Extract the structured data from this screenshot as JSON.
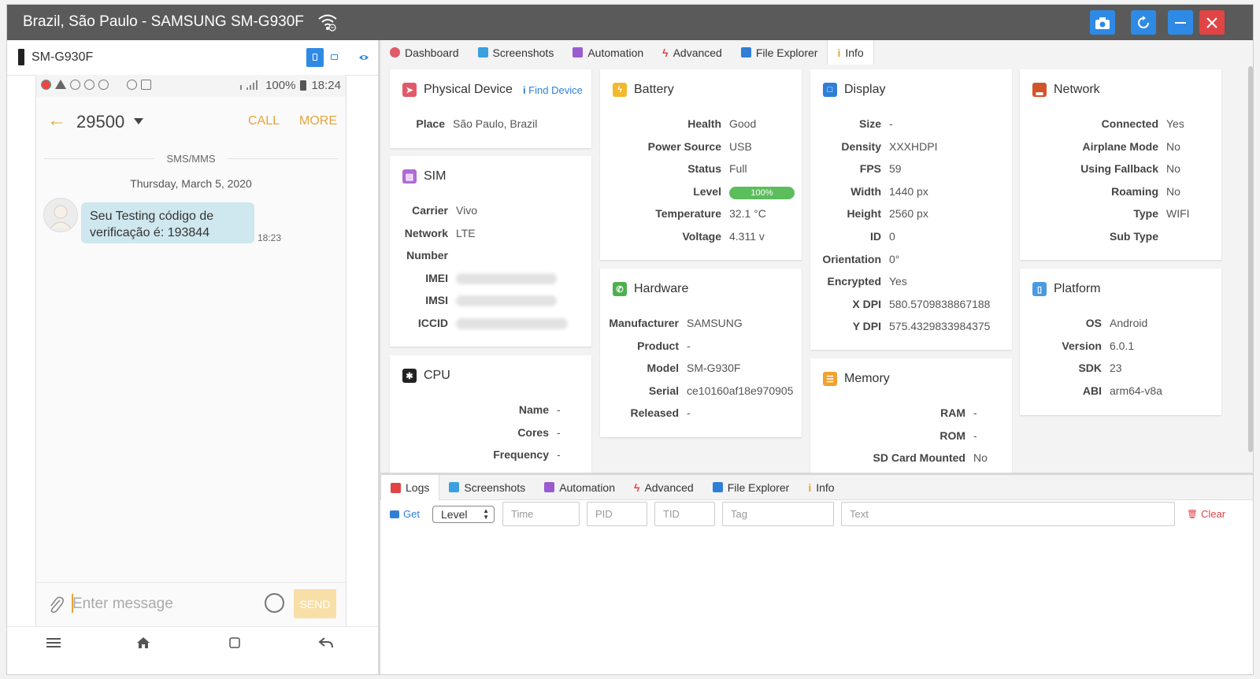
{
  "window": {
    "title": "Brazil, São Paulo - SAMSUNG SM-G930F"
  },
  "device": {
    "name": "SM-G930F"
  },
  "phone": {
    "status": {
      "battery": "100%",
      "time": "18:24"
    },
    "conversation": {
      "number": "29500",
      "call": "CALL",
      "more": "MORE"
    },
    "sms_label": "SMS/MMS",
    "date": "Thursday, March 5, 2020",
    "message": {
      "text": "Seu Testing código de verificação é: 193844",
      "time": "18:23"
    },
    "composer": {
      "placeholder": "Enter message",
      "send": "SEND"
    }
  },
  "tabs": [
    "Dashboard",
    "Screenshots",
    "Automation",
    "Advanced",
    "File Explorer",
    "Info"
  ],
  "cards": {
    "physical": {
      "title": "Physical Device",
      "find": "Find Device",
      "rows": [
        [
          "Place",
          "São Paulo, Brazil"
        ]
      ]
    },
    "sim": {
      "title": "SIM",
      "rows": [
        [
          "Carrier",
          "Vivo"
        ],
        [
          "Network",
          "LTE"
        ],
        [
          "Number",
          ""
        ],
        [
          "IMEI",
          ""
        ],
        [
          "IMSI",
          ""
        ],
        [
          "ICCID",
          ""
        ]
      ]
    },
    "cpu": {
      "title": "CPU",
      "rows": [
        [
          "Name",
          "-"
        ],
        [
          "Cores",
          "-"
        ],
        [
          "Frequency",
          "-"
        ]
      ]
    },
    "battery": {
      "title": "Battery",
      "rows": [
        [
          "Health",
          "Good"
        ],
        [
          "Power Source",
          "USB"
        ],
        [
          "Status",
          "Full"
        ],
        [
          "Level",
          "100%"
        ],
        [
          "Temperature",
          "32.1 °C"
        ],
        [
          "Voltage",
          "4.311 v"
        ]
      ],
      "level_fraction": 1.0
    },
    "hardware": {
      "title": "Hardware",
      "rows": [
        [
          "Manufacturer",
          "SAMSUNG"
        ],
        [
          "Product",
          "-"
        ],
        [
          "Model",
          "SM-G930F"
        ],
        [
          "Serial",
          "ce10160af18e970905"
        ],
        [
          "Released",
          "-"
        ]
      ]
    },
    "display": {
      "title": "Display",
      "rows": [
        [
          "Size",
          "-"
        ],
        [
          "Density",
          "XXXHDPI"
        ],
        [
          "FPS",
          "59"
        ],
        [
          "Width",
          "1440 px"
        ],
        [
          "Height",
          "2560 px"
        ],
        [
          "ID",
          "0"
        ],
        [
          "Orientation",
          "0°"
        ],
        [
          "Encrypted",
          "Yes"
        ],
        [
          "X DPI",
          "580.5709838867188"
        ],
        [
          "Y DPI",
          "575.4329833984375"
        ]
      ]
    },
    "memory": {
      "title": "Memory",
      "rows": [
        [
          "RAM",
          "-"
        ],
        [
          "ROM",
          "-"
        ],
        [
          "SD Card Mounted",
          "No"
        ]
      ]
    },
    "network": {
      "title": "Network",
      "rows": [
        [
          "Connected",
          "Yes"
        ],
        [
          "Airplane Mode",
          "No"
        ],
        [
          "Using Fallback",
          "No"
        ],
        [
          "Roaming",
          "No"
        ],
        [
          "Type",
          "WIFI"
        ],
        [
          "Sub Type",
          ""
        ]
      ]
    },
    "platform": {
      "title": "Platform",
      "rows": [
        [
          "OS",
          "Android"
        ],
        [
          "Version",
          "6.0.1"
        ],
        [
          "SDK",
          "23"
        ],
        [
          "ABI",
          "arm64-v8a"
        ]
      ]
    }
  },
  "logs": {
    "tabs": [
      "Logs",
      "Screenshots",
      "Automation",
      "Advanced",
      "File Explorer",
      "Info"
    ],
    "get": "Get",
    "level": "Level",
    "placeholders": {
      "time": "Time",
      "pid": "PID",
      "tid": "TID",
      "tag": "Tag",
      "text": "Text"
    },
    "clear": "Clear"
  },
  "colors": {
    "accent": "#2f8ae5",
    "titlebar": "#5a5a5a",
    "close": "#e04444",
    "phone_accent": "#e8a438",
    "level": "#5bbd5b"
  }
}
